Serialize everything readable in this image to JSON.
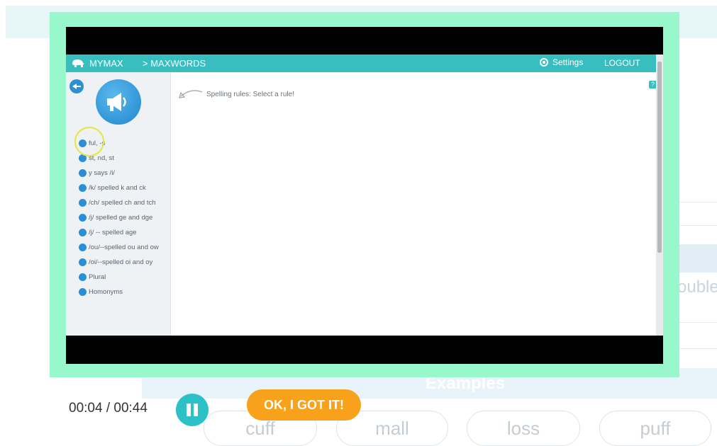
{
  "player": {
    "time_display": "00:04 / 00:44",
    "ok_label": "OK, I GOT IT!"
  },
  "video_app": {
    "nav": {
      "mymax": "MYMAX",
      "maxwords": "> MAXWORDS",
      "settings": "Settings",
      "logout": "LOGOUT"
    },
    "prompt": "Spelling rules: Select a rule!",
    "help": "?",
    "rules": [
      "ful, -s",
      "st, nd, st",
      "y says /i/",
      "/k/ spelled k and ck",
      "/ch/ spelled ch and tch",
      "/j/ spelled ge and dge",
      "/j/ -- spelled age",
      "/ou/--spelled ou and ow",
      "/oi/--spelled oi and oy",
      "Plural",
      "Homonyms"
    ]
  },
  "background": {
    "partial_word": "ouble",
    "examples_heading": "Examples",
    "example_words": [
      "cuff",
      "mall",
      "loss",
      "puff"
    ]
  },
  "colors": {
    "frame": "#98f8cc",
    "app_bar": "#39bec0",
    "pause": "#2cc0c7",
    "ok_button": "#f7a21a"
  }
}
